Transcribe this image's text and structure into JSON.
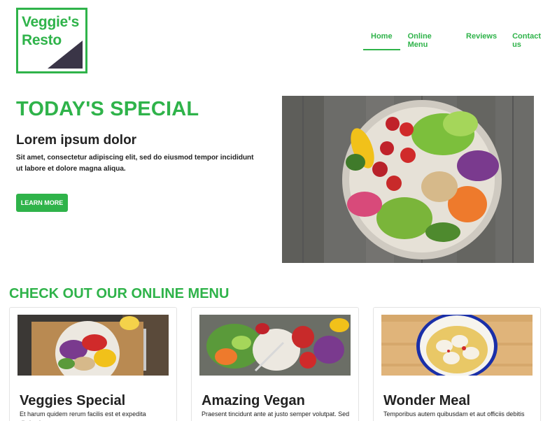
{
  "logo": {
    "line1": "Veggie's",
    "line2": "Resto"
  },
  "nav": {
    "items": [
      {
        "label": "Home"
      },
      {
        "label": "Online Menu"
      },
      {
        "label": "Reviews"
      },
      {
        "label": "Contact us"
      }
    ]
  },
  "hero": {
    "title": "TODAY'S SPECIAL",
    "subtitle": "Lorem ipsum dolor",
    "description": "Sit amet, consectetur adipiscing elit, sed do eiusmod tempor incididunt ut labore et dolore magna aliqua.",
    "button": "LEARN MORE"
  },
  "menu": {
    "title": "CHECK OUT OUR ONLINE MENU",
    "cards": [
      {
        "title": "Veggies Special",
        "text": "Et harum quidem rerum facilis est et expedita distinctio."
      },
      {
        "title": "Amazing Vegan",
        "text": "Praesent tincidunt ante at justo semper volutpat. Sed"
      },
      {
        "title": "Wonder Meal",
        "text": "Temporibus autem quibusdam et aut officiis debitis aut"
      }
    ]
  },
  "colors": {
    "accent": "#2fb34a",
    "dark": "#3a3547"
  }
}
